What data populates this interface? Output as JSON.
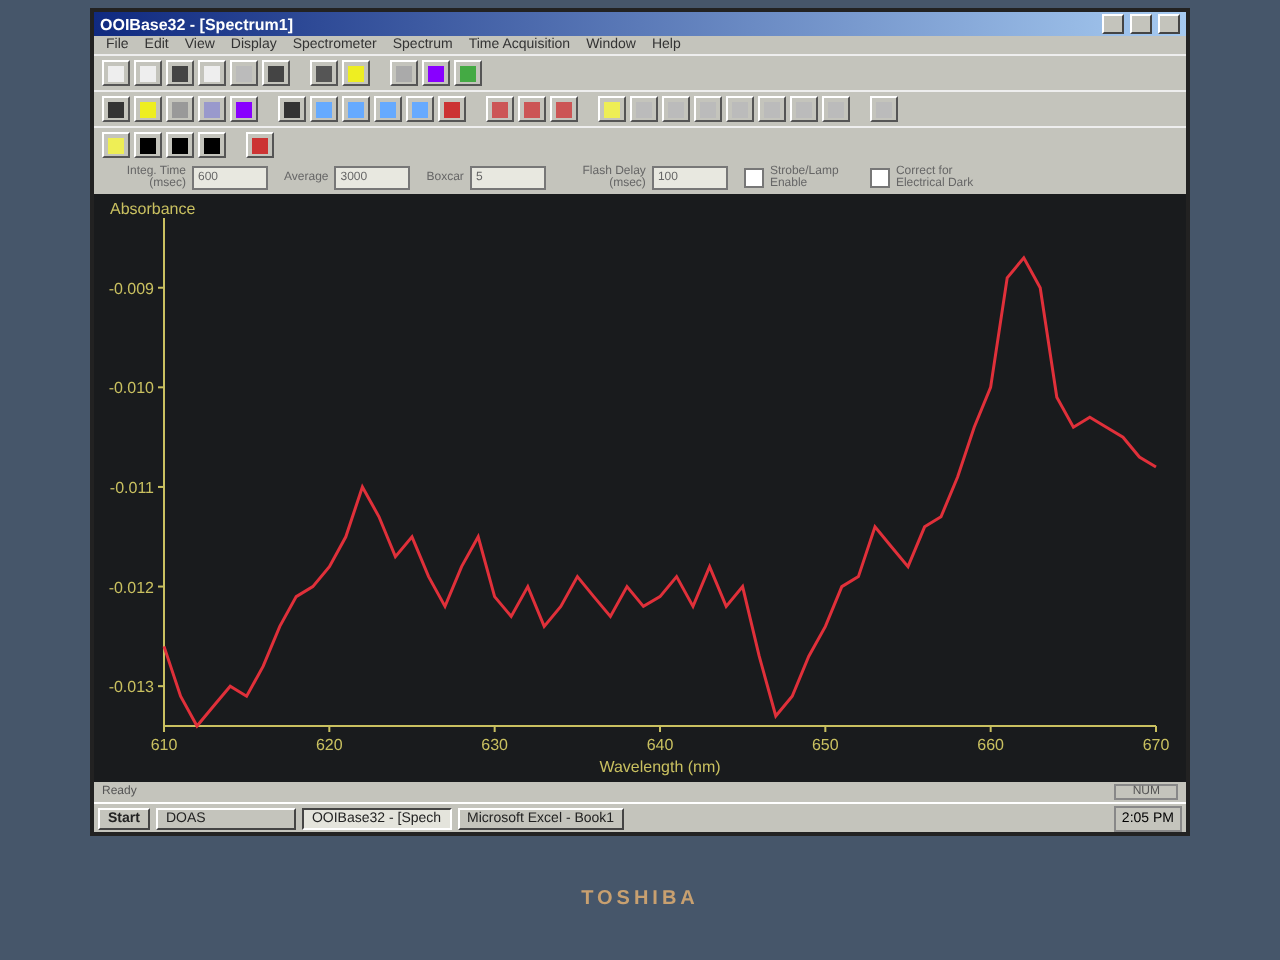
{
  "window": {
    "title": "OOIBase32 - [Spectrum1]"
  },
  "menu": [
    "File",
    "Edit",
    "View",
    "Display",
    "Spectrometer",
    "Spectrum",
    "Time Acquisition",
    "Window",
    "Help"
  ],
  "controls": [
    {
      "kind": "spin",
      "label": "Integ. Time (msec)",
      "value": "600"
    },
    {
      "kind": "spin",
      "label": "Average",
      "value": "3000"
    },
    {
      "kind": "spin",
      "label": "Boxcar",
      "value": "5"
    },
    {
      "kind": "spin",
      "label": "Flash Delay (msec)",
      "value": "100"
    },
    {
      "kind": "check",
      "label": "Strobe/Lamp Enable",
      "checked": false
    },
    {
      "kind": "check",
      "label": "Correct for Electrical Dark",
      "checked": false
    }
  ],
  "chart": {
    "chart_data": {
      "type": "line",
      "xlabel": "Wavelength (nm)",
      "ylabel": "Absorbance",
      "xlim": [
        610,
        670
      ],
      "ylim": [
        -0.0134,
        -0.0083
      ],
      "xticks": [
        610,
        620,
        630,
        640,
        650,
        660,
        670
      ],
      "yticks": [
        {
          "value": -0.009,
          "label": "-0.009"
        },
        {
          "value": -0.01,
          "label": "-0.010"
        },
        {
          "value": -0.011,
          "label": "-0.011"
        },
        {
          "value": -0.012,
          "label": "-0.012"
        },
        {
          "value": -0.013,
          "label": "-0.013"
        }
      ],
      "x": [
        610,
        611,
        612,
        613,
        614,
        615,
        616,
        617,
        618,
        619,
        620,
        621,
        622,
        623,
        624,
        625,
        626,
        627,
        628,
        629,
        630,
        631,
        632,
        633,
        634,
        635,
        636,
        637,
        638,
        639,
        640,
        641,
        642,
        643,
        644,
        645,
        646,
        647,
        648,
        649,
        650,
        651,
        652,
        653,
        654,
        655,
        656,
        657,
        658,
        659,
        660,
        661,
        662,
        663,
        664,
        665,
        666,
        667,
        668,
        669,
        670
      ],
      "series": [
        {
          "color": "#e0303a",
          "values": [
            -0.0126,
            -0.0131,
            -0.0134,
            -0.0132,
            -0.013,
            -0.0131,
            -0.0128,
            -0.0124,
            -0.0121,
            -0.012,
            -0.0118,
            -0.0115,
            -0.011,
            -0.0113,
            -0.0117,
            -0.0115,
            -0.0119,
            -0.0122,
            -0.0118,
            -0.0115,
            -0.0121,
            -0.0123,
            -0.012,
            -0.0124,
            -0.0122,
            -0.0119,
            -0.0121,
            -0.0123,
            -0.012,
            -0.0122,
            -0.0121,
            -0.0119,
            -0.0122,
            -0.0118,
            -0.0122,
            -0.012,
            -0.0127,
            -0.0133,
            -0.0131,
            -0.0127,
            -0.0124,
            -0.012,
            -0.0119,
            -0.0114,
            -0.0116,
            -0.0118,
            -0.0114,
            -0.0113,
            -0.0109,
            -0.0104,
            -0.01,
            -0.0089,
            -0.0087,
            -0.009,
            -0.0101,
            -0.0104,
            -0.0103,
            -0.0104,
            -0.0105,
            -0.0107,
            -0.0108
          ]
        }
      ]
    }
  },
  "status_bar": {
    "message": "Ready",
    "indicator": "NUM"
  },
  "taskbar": {
    "start": "Start",
    "items": [
      {
        "label": "DOAS",
        "selected": false
      },
      {
        "label": "OOIBase32 - [Spech",
        "selected": true
      },
      {
        "label": "Microsoft Excel - Book1",
        "selected": false
      }
    ],
    "clock": "2:05 PM"
  },
  "laptop": {
    "brand": "TOSHIBA"
  }
}
